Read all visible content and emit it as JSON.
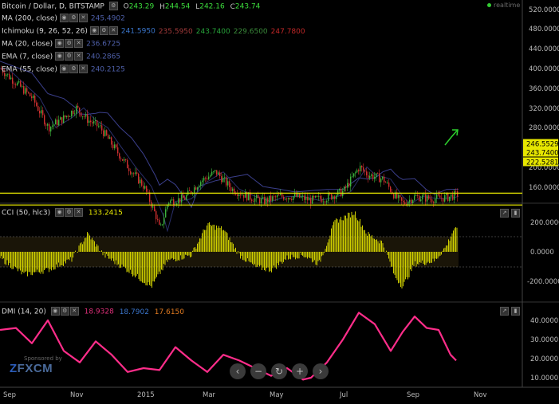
{
  "header": {
    "symbol": "Bitcoin / Dollar, D, BITSTAMP",
    "open": "243.29",
    "high": "244.54",
    "low": "242.16",
    "close": "243.74",
    "realtime": "realtime"
  },
  "indicators": [
    {
      "label": "MA (200, close)",
      "values": [
        {
          "v": "245.4902",
          "color": "#4e5fa8"
        }
      ]
    },
    {
      "label": "Ichimoku (9, 26, 52, 26)",
      "values": [
        {
          "v": "241.5950",
          "color": "#3a74c9"
        },
        {
          "v": "235.5950",
          "color": "#a33a3a"
        },
        {
          "v": "243.7400",
          "color": "#27a33a"
        },
        {
          "v": "229.6500",
          "color": "#3a8a3a"
        },
        {
          "v": "247.7800",
          "color": "#c02727"
        }
      ]
    },
    {
      "label": "MA (20, close)",
      "values": [
        {
          "v": "236.6725",
          "color": "#4e5fa8"
        }
      ]
    },
    {
      "label": "EMA (7, close)",
      "values": [
        {
          "v": "240.2865",
          "color": "#4e5fa8"
        }
      ]
    },
    {
      "label": "EMA (55, close)",
      "values": [
        {
          "v": "240.2125",
          "color": "#4e5fa8"
        }
      ]
    }
  ],
  "cci": {
    "label": "CCI (50, hlc3)",
    "value": "133.2415",
    "value_color": "#e6e600"
  },
  "dmi": {
    "label": "DMI (14, 20)",
    "values": [
      {
        "v": "18.9328",
        "color": "#e0307a"
      },
      {
        "v": "18.7902",
        "color": "#3a74c9"
      },
      {
        "v": "17.6150",
        "color": "#e07a20"
      }
    ]
  },
  "price_axis": [
    "520.0000",
    "480.0000",
    "440.0000",
    "400.0000",
    "360.0000",
    "320.0000",
    "280.0000",
    "200.0000",
    "160.0000"
  ],
  "price_markers": [
    {
      "label": "246.5529",
      "bg": "#e6e600",
      "fg": "#000"
    },
    {
      "label": "243.7400",
      "bg": "#e6e600",
      "fg": "#000"
    },
    {
      "label": "222.5281",
      "bg": "#e6e600",
      "fg": "#000"
    }
  ],
  "cci_axis": [
    "200.0000",
    "0.0000",
    "-200.0000"
  ],
  "dmi_axis": [
    "40.0000",
    "30.0000",
    "20.0000",
    "10.0000"
  ],
  "time_axis": [
    "Sep",
    "Nov",
    "2015",
    "Mar",
    "May",
    "Jul",
    "Sep",
    "Nov"
  ],
  "nav_buttons": [
    "‹",
    "−",
    "↻",
    "+",
    "›"
  ],
  "sponsor": "Sponsored by",
  "brand": {
    "z": "Z",
    "rest": "FXCM"
  },
  "colors": {
    "yellow": "#e6e600",
    "up": "#3cb43c",
    "down": "#d03030",
    "ma": "#3b3f8c",
    "dmi": "#ff2d8a"
  }
}
